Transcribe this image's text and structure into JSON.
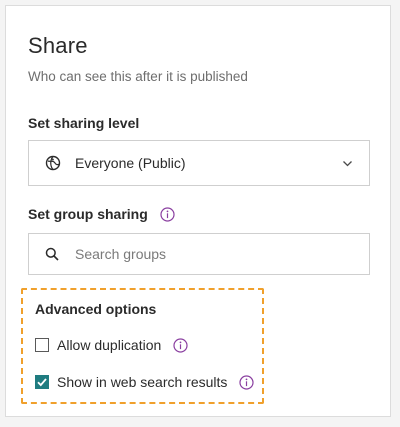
{
  "panel": {
    "title": "Share",
    "subtitle": "Who can see this after it is published"
  },
  "sharing_level": {
    "label": "Set sharing level",
    "value": "Everyone (Public)"
  },
  "group_sharing": {
    "label": "Set group sharing",
    "search_placeholder": "Search groups",
    "search_value": ""
  },
  "advanced_options": {
    "title": "Advanced options",
    "options": [
      {
        "label": "Allow duplication",
        "checked": false
      },
      {
        "label": "Show in web search results",
        "checked": true
      }
    ]
  },
  "icons": {
    "globe": "globe-icon",
    "chevron": "chevron-down-icon",
    "search": "search-icon",
    "info": "info-icon",
    "check": "checkmark-icon"
  },
  "colors": {
    "accent": "#1f7c80",
    "info_icon": "#8a3fa0",
    "highlight_border": "#f0a02c"
  }
}
